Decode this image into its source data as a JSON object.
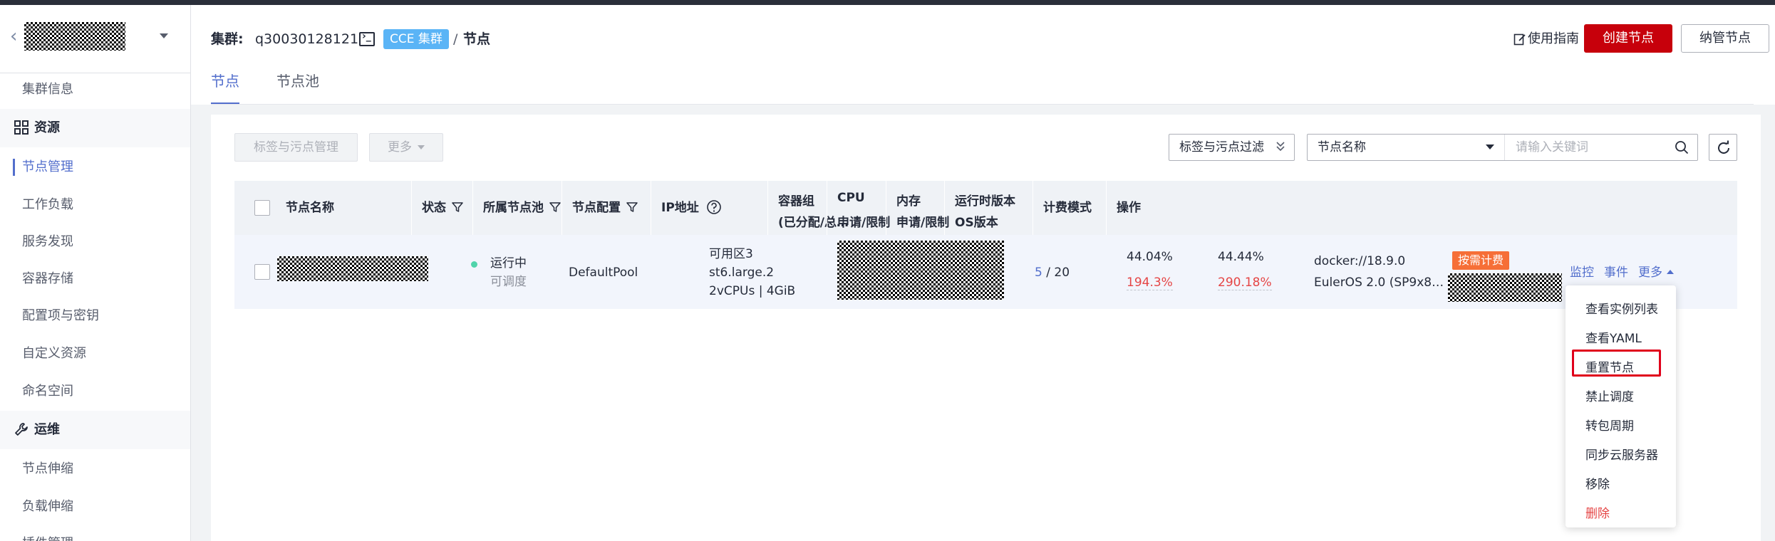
{
  "sidebar": {
    "items": [
      {
        "label": "集群信息"
      },
      {
        "label": "资源",
        "group": true
      },
      {
        "label": "节点管理",
        "active": true
      },
      {
        "label": "工作负载"
      },
      {
        "label": "服务发现"
      },
      {
        "label": "容器存储"
      },
      {
        "label": "配置项与密钥"
      },
      {
        "label": "自定义资源"
      },
      {
        "label": "命名空间"
      },
      {
        "label": "运维",
        "group": true
      },
      {
        "label": "节点伸缩"
      },
      {
        "label": "负载伸缩"
      },
      {
        "label": "插件管理"
      }
    ]
  },
  "header": {
    "cluster_label": "集群:",
    "cluster_id": "q30030128121",
    "cluster_badge": "CCE 集群",
    "separator": "/",
    "current": "节点",
    "guide_label": "使用指南",
    "create_label": "创建节点",
    "manage_label": "纳管节点"
  },
  "tabs": [
    {
      "label": "节点",
      "active": true
    },
    {
      "label": "节点池"
    }
  ],
  "toolbar": {
    "taint_label": "标签与污点管理",
    "more_label": "更多",
    "filter_label": "标签与污点过滤",
    "search_type": "节点名称",
    "search_placeholder": "请输入关键词"
  },
  "table": {
    "headers": {
      "name": "节点名称",
      "status": "状态",
      "pool": "所属节点池",
      "config": "节点配置",
      "ip": "IP地址",
      "pods_l1": "容器组",
      "pods_l2": "(已分配/总…",
      "cpu_l1": "CPU",
      "cpu_l2": "申请/限制",
      "mem_l1": "内存",
      "mem_l2": "申请/限制",
      "runtime_l1": "运行时版本",
      "runtime_l2": "OS版本",
      "billing": "计费模式",
      "ops": "操作"
    },
    "row": {
      "status": "运行中",
      "schedulable": "可调度",
      "pool": "DefaultPool",
      "config_zone": "可用区3",
      "config_flavor": "st6.large.2",
      "config_spec": "2vCPUs | 4GiB",
      "pods_used": "5",
      "pods_sep": " / ",
      "pods_total": "20",
      "cpu_request": "44.04%",
      "cpu_limit": "194.3%",
      "mem_request": "44.44%",
      "mem_limit": "290.18%",
      "runtime": "docker://18.9.0",
      "os": "EulerOS 2.0 (SP9x8…",
      "billing": "按需计费",
      "op_monitor": "监控",
      "op_events": "事件",
      "op_more": "更多"
    }
  },
  "menu": {
    "items": [
      {
        "label": "查看实例列表"
      },
      {
        "label": "查看YAML"
      },
      {
        "label": "重置节点",
        "highlighted": true
      },
      {
        "label": "禁止调度"
      },
      {
        "label": "转包周期"
      },
      {
        "label": "同步云服务器"
      },
      {
        "label": "移除"
      },
      {
        "label": "删除",
        "danger": true
      }
    ]
  },
  "colors": {
    "brand_red": "#c7000b",
    "link_blue": "#526ecc",
    "badge_blue": "#5ab4f6",
    "status_green": "#50d4ab",
    "danger_red": "#e54545",
    "billing_orange": "#f66f37",
    "highlight_red": "#e0001b"
  }
}
